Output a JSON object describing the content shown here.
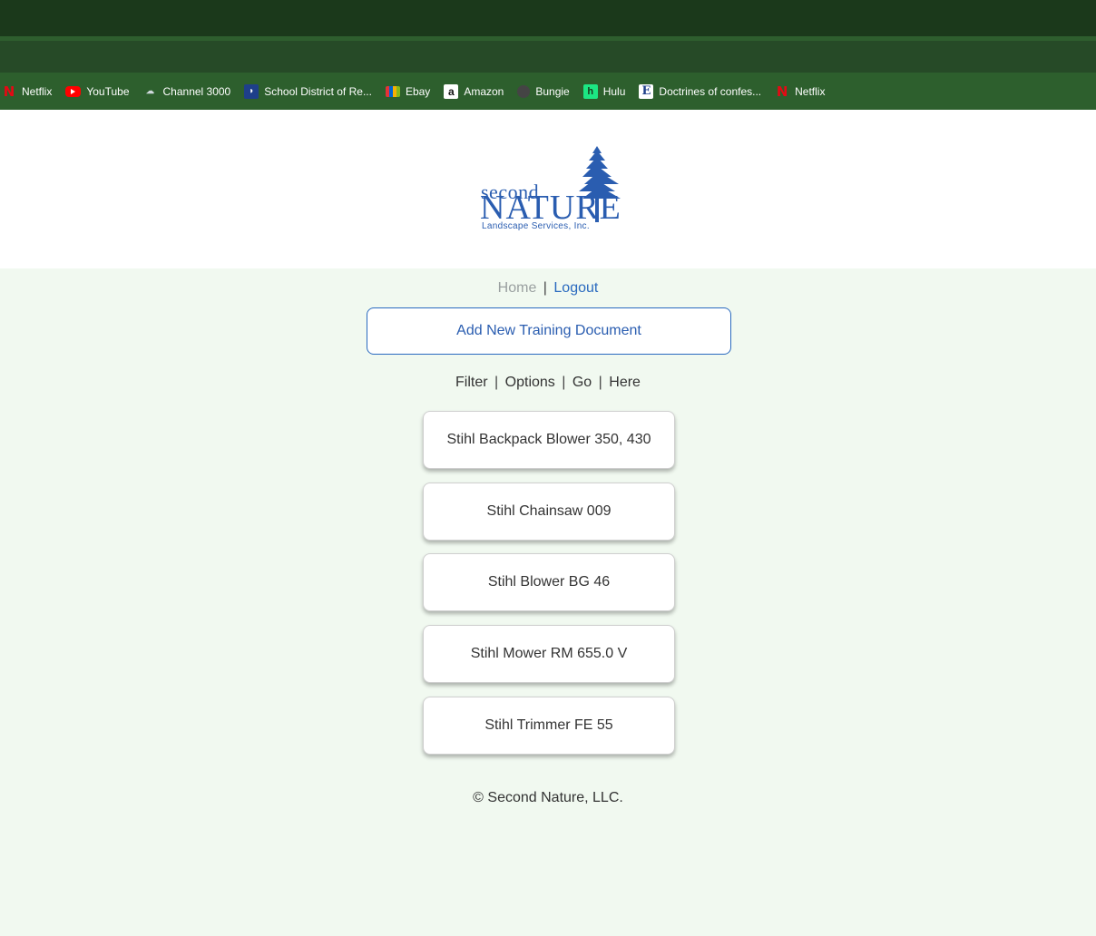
{
  "bookmarks": [
    {
      "label": "Netflix",
      "icon": "netflix-icon"
    },
    {
      "label": "YouTube",
      "icon": "youtube-icon"
    },
    {
      "label": "Channel 3000",
      "icon": "channel3000-icon"
    },
    {
      "label": "School District of Re...",
      "icon": "school-district-icon"
    },
    {
      "label": "Ebay",
      "icon": "ebay-icon"
    },
    {
      "label": "Amazon",
      "icon": "amazon-icon"
    },
    {
      "label": "Bungie",
      "icon": "bungie-icon"
    },
    {
      "label": "Hulu",
      "icon": "hulu-icon"
    },
    {
      "label": "Doctrines of confes...",
      "icon": "doctrines-icon"
    },
    {
      "label": "Netflix",
      "icon": "netflix-icon"
    }
  ],
  "logo": {
    "line1": "second",
    "line2": "NATURE",
    "line3": "Landscape Services, Inc."
  },
  "nav": {
    "home": "Home",
    "separator": "|",
    "logout": "Logout"
  },
  "add_button": "Add New Training Document",
  "filter": {
    "items": [
      "Filter",
      "Options",
      "Go",
      "Here"
    ],
    "separator": "|"
  },
  "documents": [
    "Stihl Backpack Blower 350, 430",
    "Stihl Chainsaw 009",
    "Stihl Blower BG 46",
    "Stihl Mower RM 655.0 V",
    "Stihl Trimmer FE 55"
  ],
  "footer": "© Second Nature, LLC.",
  "colors": {
    "chrome_dark": "#1b391b",
    "bookmarks_bar": "#2d5f2d",
    "page_bg": "#f1f9f0",
    "brand_blue": "#2a5db0",
    "link_blue": "#2a6abf"
  }
}
